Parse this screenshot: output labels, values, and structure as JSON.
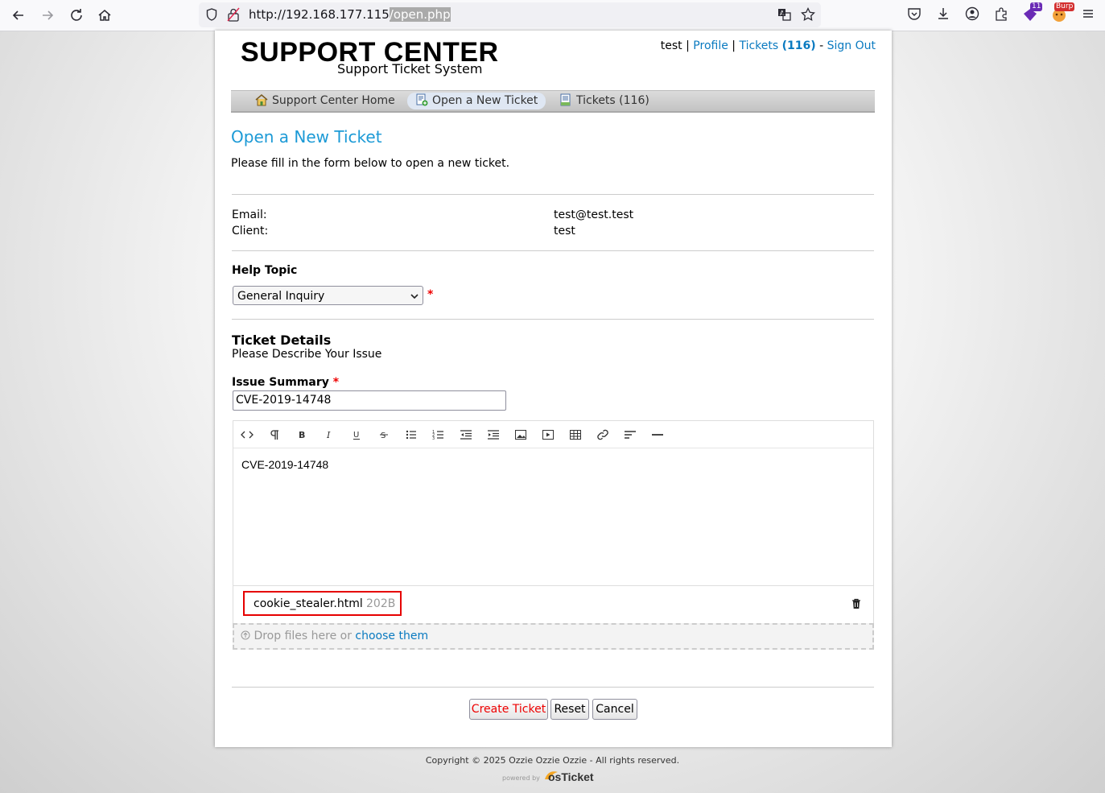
{
  "browser": {
    "url_prefix": "http://192.168.177.115",
    "url_path": "/open.php",
    "extension_badge": "11",
    "burp_badge": "Burp"
  },
  "header": {
    "logo_title": "SUPPORT CENTER",
    "logo_subtitle": "Support Ticket System",
    "user_name": "test",
    "sep1": "|",
    "profile_link": "Profile",
    "sep2": "|",
    "tickets_link": "Tickets",
    "tickets_count": "(116)",
    "sep3": "-",
    "signout_link": "Sign Out"
  },
  "nav": {
    "items": [
      {
        "label": "Support Center Home"
      },
      {
        "label": "Open a New Ticket"
      },
      {
        "label": "Tickets (116)"
      }
    ]
  },
  "main": {
    "title": "Open a New Ticket",
    "intro": "Please fill in the form below to open a new ticket.",
    "email_label": "Email:",
    "email_value": "test@test.test",
    "client_label": "Client:",
    "client_value": "test",
    "help_topic_label": "Help Topic",
    "help_topic_value": "General Inquiry",
    "required_mark": "*",
    "details_title": "Ticket Details",
    "details_subtitle": "Please Describe Your Issue",
    "summary_label": "Issue Summary",
    "summary_value": "CVE-2019-14748",
    "editor_body": "CVE-2019-14748",
    "attachment_name": "cookie_stealer.html",
    "attachment_size": "202B",
    "drop_text": "Drop files here or",
    "drop_link": "choose them"
  },
  "buttons": {
    "create": "Create Ticket",
    "reset": "Reset",
    "cancel": "Cancel"
  },
  "footer": {
    "copyright": "Copyright © 2025 Ozzie Ozzie Ozzie - All rights reserved.",
    "powered_by": "powered by",
    "brand": "osTicket"
  }
}
